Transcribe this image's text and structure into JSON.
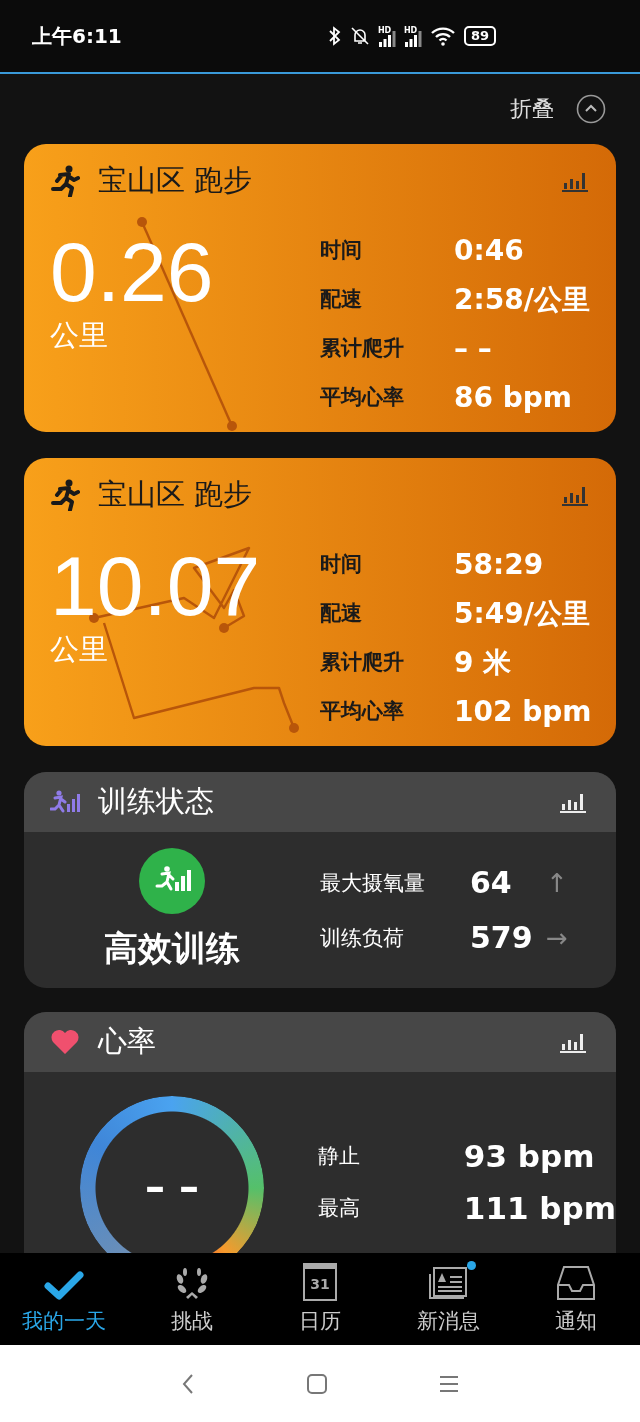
{
  "status_bar": {
    "time": "上午6:11",
    "signals": [
      {
        "label": "HD"
      },
      {
        "label": "HD"
      }
    ],
    "battery": "89"
  },
  "collapse": {
    "label": "折叠"
  },
  "activities": [
    {
      "title": "宝山区 跑步",
      "distance": "0.26",
      "unit": "公里",
      "stats": [
        {
          "label": "时间",
          "value": "0:46"
        },
        {
          "label": "配速",
          "value": "2:58/公里"
        },
        {
          "label": "累计爬升",
          "value": "– –"
        },
        {
          "label": "平均心率",
          "value": "86 bpm"
        }
      ]
    },
    {
      "title": "宝山区 跑步",
      "distance": "10.07",
      "unit": "公里",
      "stats": [
        {
          "label": "时间",
          "value": "58:29"
        },
        {
          "label": "配速",
          "value": "5:49/公里"
        },
        {
          "label": "累计爬升",
          "value": "9 米"
        },
        {
          "label": "平均心率",
          "value": "102 bpm"
        }
      ]
    }
  ],
  "training_status": {
    "title": "训练状态",
    "state": "高效训练",
    "metrics": [
      {
        "label": "最大摄氧量",
        "value": "64",
        "trend": "↑"
      },
      {
        "label": "训练负荷",
        "value": "579",
        "trend": "→"
      }
    ]
  },
  "heart_rate": {
    "title": "心率",
    "current": "– –",
    "stats": [
      {
        "label": "静止",
        "value": "93 bpm"
      },
      {
        "label": "最高",
        "value": "111 bpm"
      }
    ]
  },
  "tabs": [
    {
      "label": "我的一天",
      "selected": true,
      "badge": false
    },
    {
      "label": "挑战",
      "selected": false,
      "badge": false
    },
    {
      "label": "日历",
      "icon_text": "31",
      "selected": false,
      "badge": false
    },
    {
      "label": "新消息",
      "selected": false,
      "badge": true
    },
    {
      "label": "通知",
      "selected": false,
      "badge": false
    }
  ]
}
